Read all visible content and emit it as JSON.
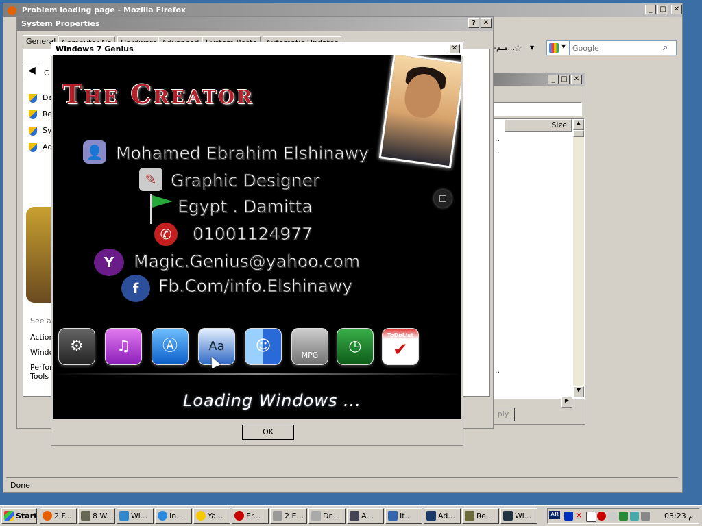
{
  "firefox": {
    "title": "Problem loading page - Mozilla Firefox",
    "status": "Done",
    "search_placeholder": "Google",
    "arabic_url_fragment": "مـم-ا..."
  },
  "system_properties": {
    "title": "System Properties",
    "tabs": [
      "General",
      "Computer Na",
      "Hardware",
      "Advanced",
      "System Resto",
      "Automatic Updates"
    ],
    "left_items": [
      "De",
      "Re",
      "Sy",
      "Ad"
    ],
    "left_label_c": "C",
    "see_also": "See al",
    "links": [
      "Action",
      "Windo",
      "Perfor Tools"
    ],
    "apply_label": "ply"
  },
  "explorer": {
    "size_column": "Size",
    "dots": [
      "..",
      "..",
      ".."
    ]
  },
  "genius": {
    "title": "Windows 7 Genius",
    "creator_heading": "The Creator",
    "name": "Mohamed Ebrahim Elshinawy",
    "role": "Graphic Designer",
    "location": "Egypt . Damitta",
    "phone": "01001124977",
    "email": "Magic.Genius@yahoo.com",
    "facebook": "Fb.Com/info.Elshinawy",
    "loading": "Loading Windows ...",
    "ok_label": "OK",
    "todo_label": "ToDoList",
    "mpg_label": "MPG",
    "font_label": "Aa"
  },
  "taskbar": {
    "start": "Start",
    "buttons": [
      "2 F...",
      "8 W...",
      "Wi...",
      "In...",
      "Ya...",
      "Er...",
      "2 E...",
      "Dr...",
      "A...",
      "It...",
      "Ad...",
      "Re...",
      "Wi..."
    ],
    "tray_lang": "AR",
    "clock": "03:23 م"
  },
  "colors": {
    "title_active": "#0a246a",
    "desktop": "#3a6ea5",
    "creator_red": "#b3202a"
  }
}
